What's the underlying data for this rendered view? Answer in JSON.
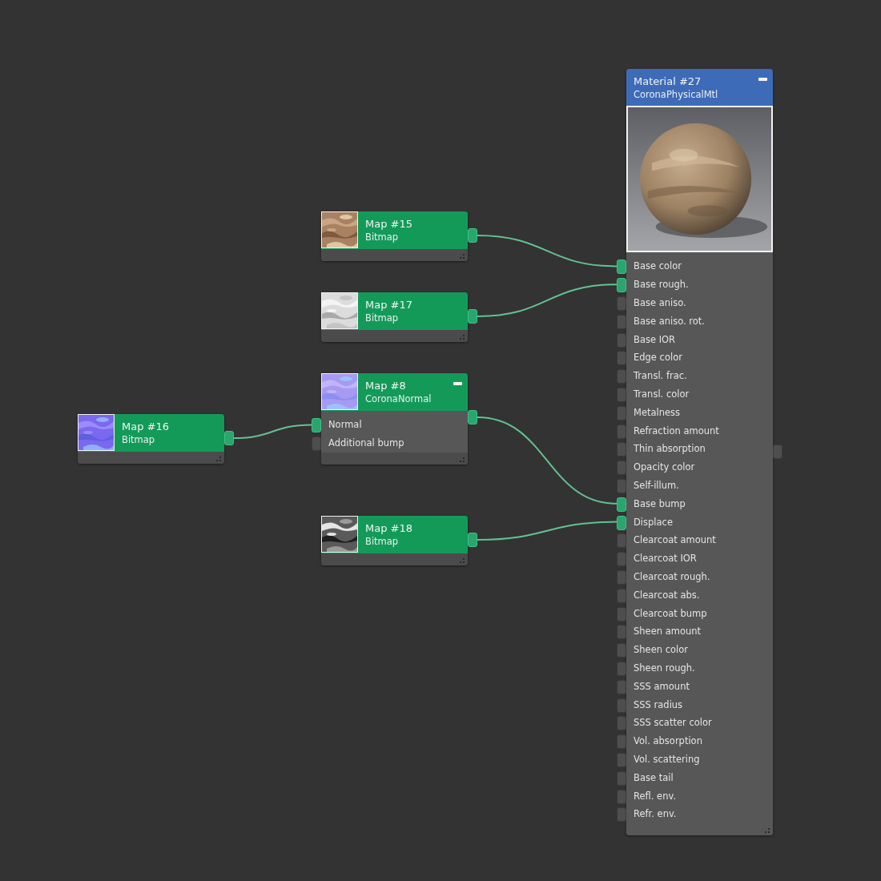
{
  "graph": {
    "root": {
      "kind": "material",
      "title": "Material #27",
      "type": "CoronaPhysicalMtl",
      "collapsible": true,
      "output_connected": false,
      "inputs": [
        {
          "label": "Base color",
          "source": {
            "kind": "map",
            "title": "Map #15",
            "type": "Bitmap",
            "output_connected": true
          }
        },
        {
          "label": "Base rough.",
          "source": {
            "kind": "map",
            "title": "Map #17",
            "type": "Bitmap",
            "output_connected": true
          }
        },
        {
          "label": "Base aniso."
        },
        {
          "label": "Base aniso. rot."
        },
        {
          "label": "Base IOR"
        },
        {
          "label": "Edge color"
        },
        {
          "label": "Transl. frac."
        },
        {
          "label": "Transl. color"
        },
        {
          "label": "Metalness"
        },
        {
          "label": "Refraction amount"
        },
        {
          "label": "Thin absorption"
        },
        {
          "label": "Opacity color"
        },
        {
          "label": "Self-illum."
        },
        {
          "label": "Base bump",
          "source": {
            "kind": "map",
            "title": "Map #8",
            "type": "CoronaNormal",
            "collapsible": true,
            "output_connected": true,
            "inputs": [
              {
                "label": "Normal",
                "source": {
                  "kind": "map",
                  "title": "Map #16",
                  "type": "Bitmap",
                  "output_connected": true
                }
              },
              {
                "label": "Additional bump"
              }
            ]
          }
        },
        {
          "label": "Displace",
          "source": {
            "kind": "map",
            "title": "Map #18",
            "type": "Bitmap",
            "output_connected": true
          }
        },
        {
          "label": "Clearcoat amount"
        },
        {
          "label": "Clearcoat IOR"
        },
        {
          "label": "Clearcoat rough."
        },
        {
          "label": "Clearcoat abs."
        },
        {
          "label": "Clearcoat bump"
        },
        {
          "label": "Sheen amount"
        },
        {
          "label": "Sheen color"
        },
        {
          "label": "Sheen rough."
        },
        {
          "label": "SSS amount"
        },
        {
          "label": "SSS radius"
        },
        {
          "label": "SSS scatter color"
        },
        {
          "label": "Vol. absorption"
        },
        {
          "label": "Vol. scattering"
        },
        {
          "label": "Base tail"
        },
        {
          "label": "Refl. env."
        },
        {
          "label": "Refr. env."
        }
      ]
    }
  }
}
